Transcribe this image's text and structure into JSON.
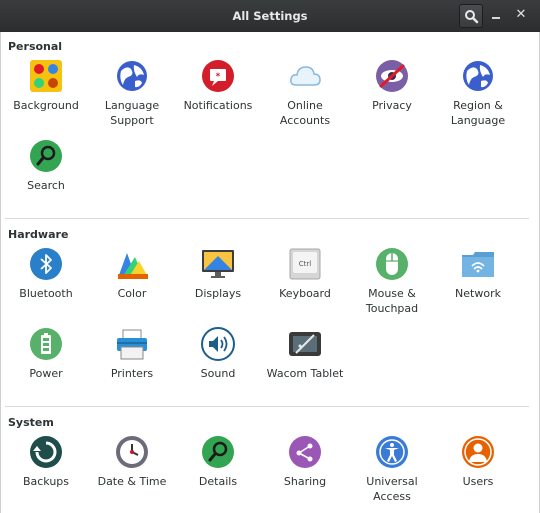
{
  "window": {
    "title": "All Settings"
  },
  "sections": [
    {
      "title": "Personal",
      "items": [
        {
          "label": "Background",
          "icon": "background-icon"
        },
        {
          "label": "Language\nSupport",
          "icon": "language-support-icon"
        },
        {
          "label": "Notifications",
          "icon": "notifications-icon"
        },
        {
          "label": "Online\nAccounts",
          "icon": "online-accounts-icon"
        },
        {
          "label": "Privacy",
          "icon": "privacy-icon"
        },
        {
          "label": "Region &\nLanguage",
          "icon": "region-language-icon"
        },
        {
          "label": "Search",
          "icon": "search-icon"
        }
      ]
    },
    {
      "title": "Hardware",
      "items": [
        {
          "label": "Bluetooth",
          "icon": "bluetooth-icon"
        },
        {
          "label": "Color",
          "icon": "color-icon"
        },
        {
          "label": "Displays",
          "icon": "displays-icon"
        },
        {
          "label": "Keyboard",
          "icon": "keyboard-icon",
          "keycap": "Ctrl"
        },
        {
          "label": "Mouse &\nTouchpad",
          "icon": "mouse-icon"
        },
        {
          "label": "Network",
          "icon": "network-icon"
        },
        {
          "label": "Power",
          "icon": "power-icon"
        },
        {
          "label": "Printers",
          "icon": "printers-icon"
        },
        {
          "label": "Sound",
          "icon": "sound-icon"
        },
        {
          "label": "Wacom Tablet",
          "icon": "wacom-tablet-icon"
        }
      ]
    },
    {
      "title": "System",
      "items": [
        {
          "label": "Backups",
          "icon": "backups-icon"
        },
        {
          "label": "Date & Time",
          "icon": "date-time-icon"
        },
        {
          "label": "Details",
          "icon": "details-icon"
        },
        {
          "label": "Sharing",
          "icon": "sharing-icon"
        },
        {
          "label": "Universal\nAccess",
          "icon": "universal-access-icon"
        },
        {
          "label": "Users",
          "icon": "users-icon"
        }
      ]
    }
  ]
}
